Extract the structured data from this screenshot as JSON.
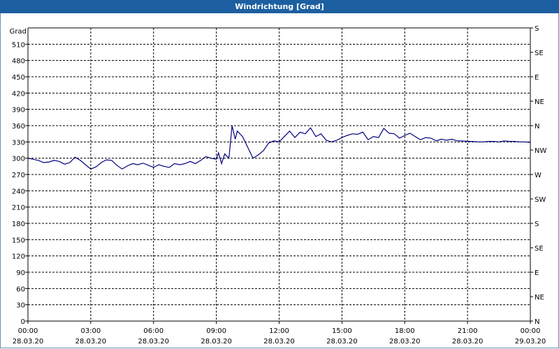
{
  "window": {
    "title": "Windrichtung [Grad]"
  },
  "chart_data": {
    "type": "line",
    "title": "Windrichtung [Grad]",
    "ylabel": "Grad",
    "ylim": [
      0,
      540
    ],
    "yticks": [
      0,
      30,
      60,
      90,
      120,
      150,
      180,
      210,
      240,
      270,
      300,
      330,
      360,
      390,
      420,
      450,
      480,
      510
    ],
    "right_ticks": [
      {
        "value": 0,
        "label": "N"
      },
      {
        "value": 45,
        "label": "NE"
      },
      {
        "value": 90,
        "label": "E"
      },
      {
        "value": 135,
        "label": "SE"
      },
      {
        "value": 180,
        "label": "S"
      },
      {
        "value": 225,
        "label": "SW"
      },
      {
        "value": 270,
        "label": "W"
      },
      {
        "value": 315,
        "label": "NW"
      },
      {
        "value": 360,
        "label": "N"
      },
      {
        "value": 405,
        "label": "NE"
      },
      {
        "value": 450,
        "label": "E"
      },
      {
        "value": 495,
        "label": "SE"
      },
      {
        "value": 540,
        "label": "S"
      }
    ],
    "xlim": [
      0,
      24
    ],
    "xticks": [
      {
        "time": "00:00",
        "date": "28.03.20"
      },
      {
        "time": "03:00",
        "date": "28.03.20"
      },
      {
        "time": "06:00",
        "date": "28.03.20"
      },
      {
        "time": "09:00",
        "date": "28.03.20"
      },
      {
        "time": "12:00",
        "date": "28.03.20"
      },
      {
        "time": "15:00",
        "date": "28.03.20"
      },
      {
        "time": "18:00",
        "date": "28.03.20"
      },
      {
        "time": "21:00",
        "date": "28.03.20"
      },
      {
        "time": "00:00",
        "date": "29.03.20"
      }
    ],
    "grid": true,
    "line_color": "#00007f",
    "series": [
      {
        "x": [
          0,
          0.25,
          0.5,
          0.75,
          1,
          1.25,
          1.5,
          1.75,
          2,
          2.25,
          2.5,
          2.75,
          3,
          3.25,
          3.5,
          3.75,
          4,
          4.25,
          4.5,
          4.75,
          5,
          5.25,
          5.5,
          5.75,
          6,
          6.25,
          6.5,
          6.75,
          7,
          7.25,
          7.5,
          7.75,
          8,
          8.25,
          8.5,
          8.75,
          9,
          9.1,
          9.25,
          9.4,
          9.6,
          9.75,
          9.9,
          10,
          10.25,
          10.5,
          10.75,
          11,
          11.25,
          11.5,
          11.75,
          12,
          12.25,
          12.5,
          12.75,
          13,
          13.25,
          13.5,
          13.75,
          14,
          14.25,
          14.5,
          14.75,
          15,
          15.25,
          15.5,
          15.75,
          16,
          16.25,
          16.5,
          16.75,
          17,
          17.25,
          17.5,
          17.75,
          18,
          18.25,
          18.5,
          18.75,
          19,
          19.25,
          19.5,
          19.75,
          20,
          20.25,
          20.5,
          20.75,
          21,
          21.25,
          21.5,
          21.75,
          22,
          22.25,
          22.5,
          22.75,
          23,
          23.25,
          23.5,
          23.75,
          24
        ],
        "y": [
          300,
          298,
          296,
          292,
          293,
          296,
          294,
          289,
          292,
          302,
          296,
          288,
          280,
          284,
          292,
          297,
          296,
          287,
          280,
          286,
          290,
          288,
          291,
          287,
          283,
          288,
          285,
          283,
          290,
          288,
          290,
          294,
          290,
          296,
          303,
          300,
          298,
          310,
          290,
          308,
          300,
          360,
          335,
          350,
          340,
          320,
          300,
          306,
          314,
          328,
          332,
          330,
          340,
          350,
          338,
          348,
          345,
          356,
          340,
          345,
          333,
          330,
          333,
          338,
          342,
          345,
          344,
          348,
          334,
          340,
          338,
          355,
          346,
          345,
          337,
          342,
          346,
          340,
          334,
          338,
          337,
          332,
          335,
          333,
          335,
          332,
          332,
          331,
          331,
          330,
          330,
          331,
          331,
          330,
          332,
          331,
          331,
          330,
          330,
          329
        ]
      }
    ]
  }
}
